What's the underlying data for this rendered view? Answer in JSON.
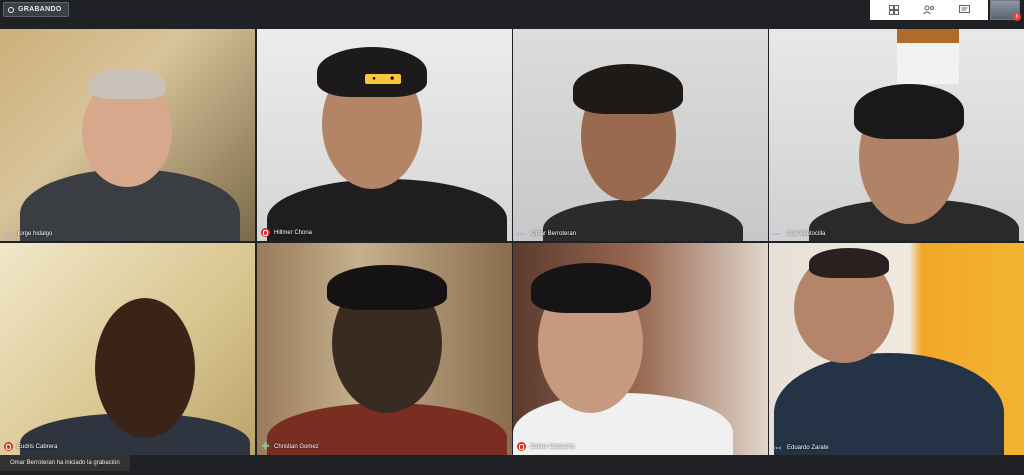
{
  "recording": {
    "label": "GRABANDO"
  },
  "toolbar": {
    "icons": [
      "grid-layout-icon",
      "add-people-icon",
      "chat-icon"
    ],
    "self_view_badge": "6"
  },
  "participants": [
    {
      "name": "jorge hidalgo",
      "status": "speaking"
    },
    {
      "name": "Hillmer Chona",
      "status": "muted"
    },
    {
      "name": "Omar Berroteran",
      "status": "speaking"
    },
    {
      "name": "Luis Ventocilla",
      "status": "speaking"
    },
    {
      "name": "Eudris Cabrera",
      "status": "muted"
    },
    {
      "name": "Christian Gomez",
      "status": "pinned"
    },
    {
      "name": "Carlos Camacho",
      "status": "muted"
    },
    {
      "name": "Eduardo Zarate",
      "status": "speaking"
    }
  ],
  "notification": {
    "text": "Omar Berroteran ha iniciado la grabación"
  },
  "colors": {
    "background": "#202124",
    "muted": "#d93025",
    "speaking": "#8ab4f8",
    "pinned": "#81c995"
  }
}
